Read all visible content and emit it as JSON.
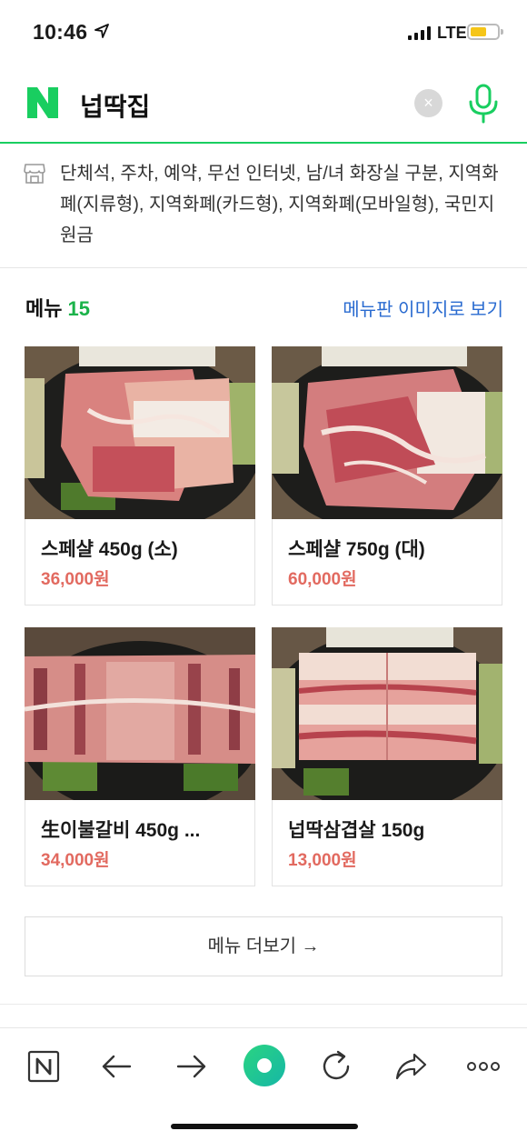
{
  "status": {
    "time": "10:46",
    "network": "LTE",
    "battery_color": "#f5c518"
  },
  "search": {
    "logo_text": "N",
    "query": "넙딱집",
    "clear_glyph": "×"
  },
  "facility": {
    "text": "단체석, 주차, 예약, 무선 인터넷, 남/녀 화장실 구분, 지역화폐(지류형), 지역화폐(카드형), 지역화폐(모바일형), 국민지원금"
  },
  "menu": {
    "title": "메뉴",
    "count": "15",
    "view_image_link": "메뉴판 이미지로 보기",
    "items": [
      {
        "name": "스페샬 450g (소)",
        "price": "36,000원"
      },
      {
        "name": "스페샬 750g (대)",
        "price": "60,000원"
      },
      {
        "name": "生이불갈비 450g ...",
        "price": "34,000원"
      },
      {
        "name": "넙딱삼겹살 150g",
        "price": "13,000원"
      }
    ],
    "more_label": "메뉴 더보기 →"
  },
  "toolbar": {
    "home_glyph": "N"
  },
  "colors": {
    "brand_green": "#19ce60",
    "price_red": "#e26a60",
    "link_blue": "#2a6bd0",
    "count_green": "#1bb34a"
  }
}
